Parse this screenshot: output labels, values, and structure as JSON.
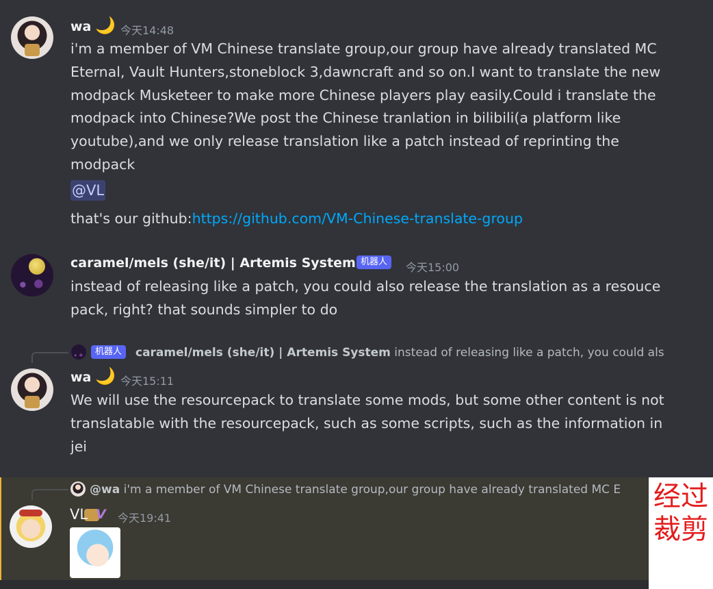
{
  "messages": [
    {
      "author": "wa",
      "timestamp": "今天14:48",
      "paragraphs": [
        "i'm a member of VM Chinese translate group,our group have already translated MC Eternal, Vault Hunters,stoneblock 3,dawncraft and so on.I want to translate the new modpack Musketeer to make more Chinese players play easily.Could i translate the modpack into Chinese?We post the Chinese tranlation in bilibili(a platform like youtube),and we only release translation like a patch instead of reprinting the modpack"
      ],
      "mention": "@VL",
      "github_prefix": "that's our github:",
      "github_link": "https://github.com/VM-Chinese-translate-group"
    },
    {
      "author": "caramel/mels (she/it) | Artemis System",
      "badge": "机器人",
      "timestamp": "今天15:00",
      "text": "instead of releasing like a patch, you could also release the translation as a resouce pack, right? that sounds simpler to do"
    },
    {
      "reply": {
        "badge": "机器人",
        "author": "caramel/mels (she/it) | Artemis System",
        "text": "instead of releasing like a patch, you could als"
      },
      "author": "wa",
      "timestamp": "今天15:11",
      "text": "We will use the resourcepack to translate some mods, but some other content is not translatable with the resourcepack, such as some scripts, such as the information in jei"
    },
    {
      "reply": {
        "author": "@wa",
        "text": "i'm a member of VM Chinese translate group,our group have already translated MC E"
      },
      "author": "VL",
      "timestamp": "今天19:41"
    }
  ],
  "watermark": "经过裁剪",
  "colors": {
    "background": "#313338",
    "highlight": "#3b3a33",
    "link": "#00a8fc",
    "bot_badge": "#5865f2",
    "watermark": "#e31c1c"
  },
  "icons": {
    "status_moon": "crescent-moon-icon"
  }
}
